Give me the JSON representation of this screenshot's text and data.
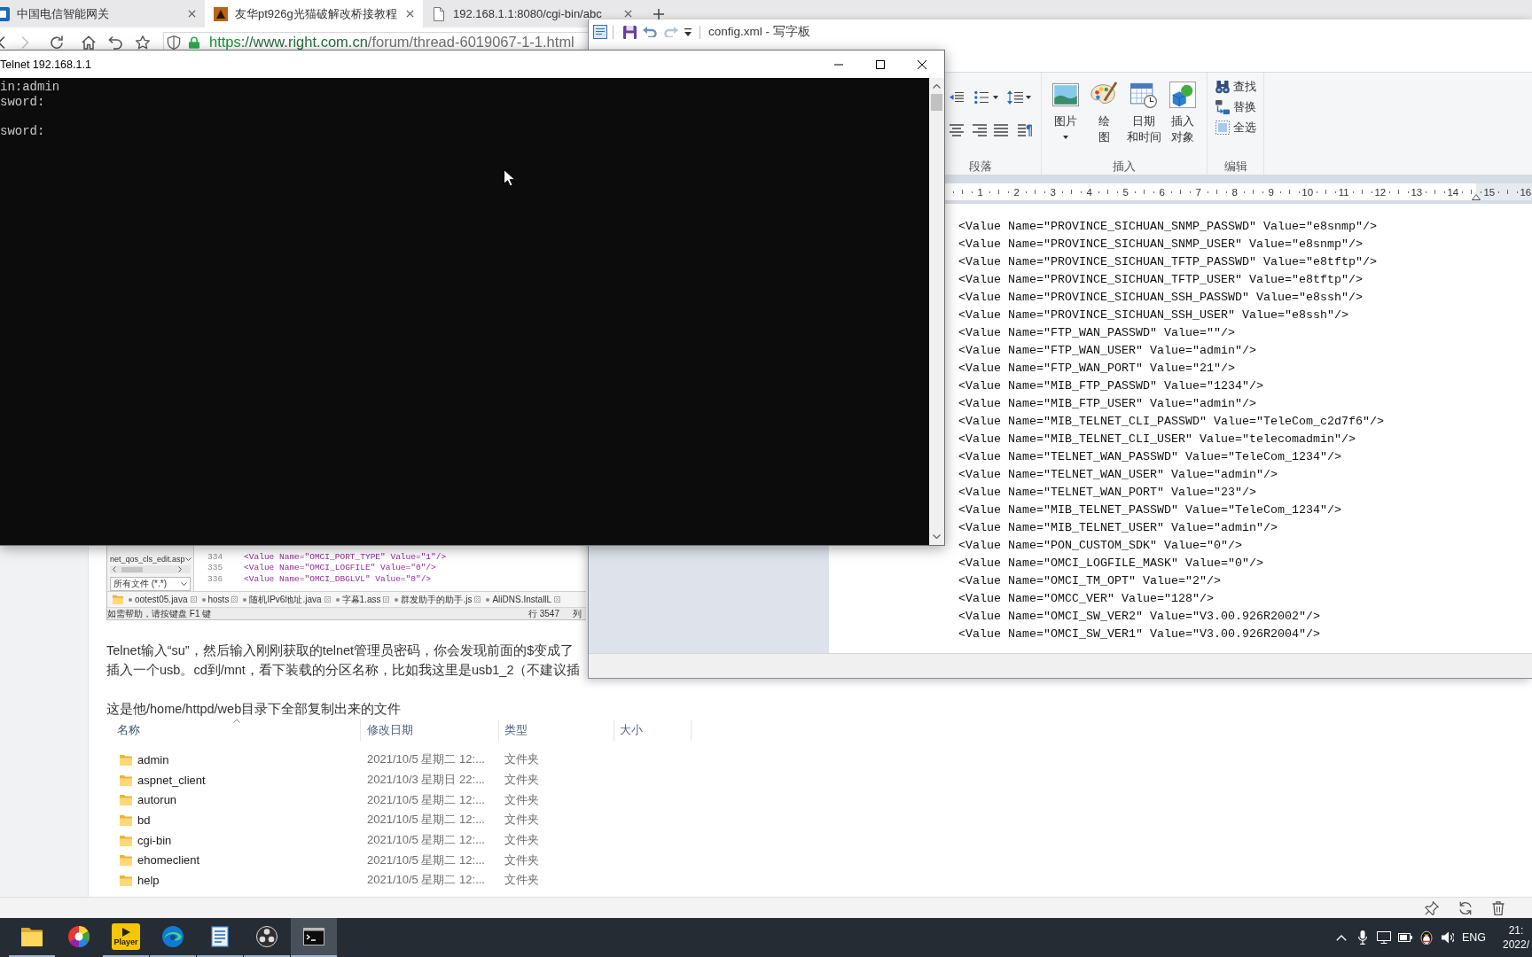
{
  "browser": {
    "tabs": [
      {
        "title": "中国电信智能网关",
        "selected": false
      },
      {
        "title": "友华pt926g光猫破解改桥接教程",
        "selected": true
      },
      {
        "title": "192.168.1.1:8080/cgi-bin/abc",
        "selected": false
      }
    ],
    "forward": {
      "disabled": true
    },
    "address": {
      "url": [
        {
          "text": "https",
          "kind": "scheme"
        },
        {
          "text": "://www.right.com.cn",
          "kind": "host"
        },
        {
          "text": "/forum/thread-6019067-1-1.html",
          "kind": "path"
        }
      ]
    },
    "article": {
      "embedded_editor": {
        "file_list": [
          "net_qos_cls_edit.asp"
        ],
        "filter": "所有文件 (*.*)",
        "code": [
          {
            "number": "334",
            "text": "<Value Name=\"OMCI_PORT_TYPE\" Value=\"1\"/>"
          },
          {
            "number": "335",
            "text": "<Value Name=\"OMCI_LOGFILE\" Value=\"0\"/>"
          },
          {
            "number": "336",
            "text": "<Value Name=\"OMCI_DBGLVL\" Value=\"0\"/>"
          }
        ],
        "tabs": [
          "ootest05.java",
          "hosts",
          "随机IPv6地址.java",
          "字幕1.ass",
          "群发助手的助手.js",
          "AliDNS.InstallL"
        ],
        "status": "如需帮助，请按键盘 F1 键",
        "position": [
          "行 3547",
          "列"
        ]
      },
      "paragraph_lines": [
        "Telnet输入“su”，然后输入刚刚获取的telnet管理员密码，你会发现前面的$变成了",
        "插入一个usb。cd到/mnt，看下装载的分区名称，比如我这里是usb1_2（不建议插"
      ],
      "caption": "这是他/home/httpd/web目录下全部复制出来的文件",
      "file_list": {
        "columns": [
          {
            "label": "名称",
            "sorted": true
          },
          {
            "label": "修改日期",
            "sorted": false
          },
          {
            "label": "类型",
            "sorted": false
          },
          {
            "label": "大小",
            "sorted": false
          }
        ],
        "rows": [
          {
            "name": "admin",
            "modified": "2021/10/5 星期二 12:...",
            "type": "文件夹"
          },
          {
            "name": "aspnet_client",
            "modified": "2021/10/3 星期日 22:...",
            "type": "文件夹"
          },
          {
            "name": "autorun",
            "modified": "2021/10/5 星期二 12:...",
            "type": "文件夹"
          },
          {
            "name": "bd",
            "modified": "2021/10/5 星期二 12:...",
            "type": "文件夹"
          },
          {
            "name": "cgi-bin",
            "modified": "2021/10/5 星期二 12:...",
            "type": "文件夹"
          },
          {
            "name": "ehomeclient",
            "modified": "2021/10/5 星期二 12:...",
            "type": "文件夹"
          },
          {
            "name": "help",
            "modified": "2021/10/5 星期二 12:...",
            "type": "文件夹"
          }
        ]
      }
    }
  },
  "wordpad": {
    "title": "config.xml - 写字板",
    "ribbon": {
      "groups": [
        {
          "label": "段落",
          "kind": "paragraph"
        },
        {
          "label": "插入",
          "kind": "insert",
          "buttons": [
            {
              "lines": [
                "图片"
              ],
              "dropdown": true
            },
            {
              "lines": [
                "绘",
                "图"
              ],
              "dropdown": false
            },
            {
              "lines": [
                "日期",
                "和时间"
              ],
              "dropdown": false
            },
            {
              "lines": [
                "插入",
                "对象"
              ],
              "dropdown": false
            }
          ]
        },
        {
          "label": "编辑",
          "kind": "edit",
          "buttons": [
            {
              "label": "查找"
            },
            {
              "label": "替换"
            },
            {
              "label": "全选"
            }
          ]
        }
      ]
    },
    "ruler": {
      "numbers": [
        "1",
        "2",
        "3",
        "4",
        "5",
        "6",
        "7",
        "8",
        "9",
        "10",
        "11",
        "12",
        "13",
        "14",
        "15",
        "16"
      ]
    },
    "document": {
      "lines": [
        "<Value Name=\"PROVINCE_SICHUAN_SNMP_PASSWD\" Value=\"e8snmp\"/>",
        "<Value Name=\"PROVINCE_SICHUAN_SNMP_USER\" Value=\"e8snmp\"/>",
        "<Value Name=\"PROVINCE_SICHUAN_TFTP_PASSWD\" Value=\"e8tftp\"/>",
        "<Value Name=\"PROVINCE_SICHUAN_TFTP_USER\" Value=\"e8tftp\"/>",
        "<Value Name=\"PROVINCE_SICHUAN_SSH_PASSWD\" Value=\"e8ssh\"/>",
        "<Value Name=\"PROVINCE_SICHUAN_SSH_USER\" Value=\"e8ssh\"/>",
        "<Value Name=\"FTP_WAN_PASSWD\" Value=\"\"/>",
        "<Value Name=\"FTP_WAN_USER\" Value=\"admin\"/>",
        "<Value Name=\"FTP_WAN_PORT\" Value=\"21\"/>",
        "<Value Name=\"MIB_FTP_PASSWD\" Value=\"1234\"/>",
        "<Value Name=\"MIB_FTP_USER\" Value=\"admin\"/>",
        "<Value Name=\"MIB_TELNET_CLI_PASSWD\" Value=\"TeleCom_c2d7f6\"/>",
        "<Value Name=\"MIB_TELNET_CLI_USER\" Value=\"telecomadmin\"/>",
        "<Value Name=\"TELNET_WAN_PASSWD\" Value=\"TeleCom_1234\"/>",
        "<Value Name=\"TELNET_WAN_USER\" Value=\"admin\"/>",
        "<Value Name=\"TELNET_WAN_PORT\" Value=\"23\"/>",
        "<Value Name=\"MIB_TELNET_PASSWD\" Value=\"TeleCom_1234\"/>",
        "<Value Name=\"MIB_TELNET_USER\" Value=\"admin\"/>",
        "<Value Name=\"PON_CUSTOM_SDK\" Value=\"0\"/>",
        "<Value Name=\"OMCI_LOGFILE_MASK\" Value=\"0\"/>",
        "<Value Name=\"OMCI_TM_OPT\" Value=\"2\"/>",
        "<Value Name=\"OMCC_VER\" Value=\"128\"/>",
        "<Value Name=\"OMCI_SW_VER2\" Value=\"V3.00.926R2002\"/>",
        "<Value Name=\"OMCI_SW_VER1\" Value=\"V3.00.926R2004\"/>"
      ]
    }
  },
  "telnet": {
    "title": "Telnet 192.168.1.1",
    "output": [
      [
        "in:admin",
        "sword:"
      ],
      [
        "sword:"
      ]
    ]
  },
  "taskbar": {
    "apps": [
      {
        "running": true,
        "selected": false
      },
      {
        "running": false,
        "selected": false
      },
      {
        "running": true,
        "selected": false,
        "label": "Player"
      },
      {
        "running": true,
        "selected": false
      },
      {
        "running": true,
        "selected": false
      },
      {
        "running": true,
        "selected": false
      },
      {
        "running": true,
        "selected": true
      }
    ],
    "tray": {
      "language": "ENG",
      "time": "21:",
      "date": "2022/"
    }
  }
}
